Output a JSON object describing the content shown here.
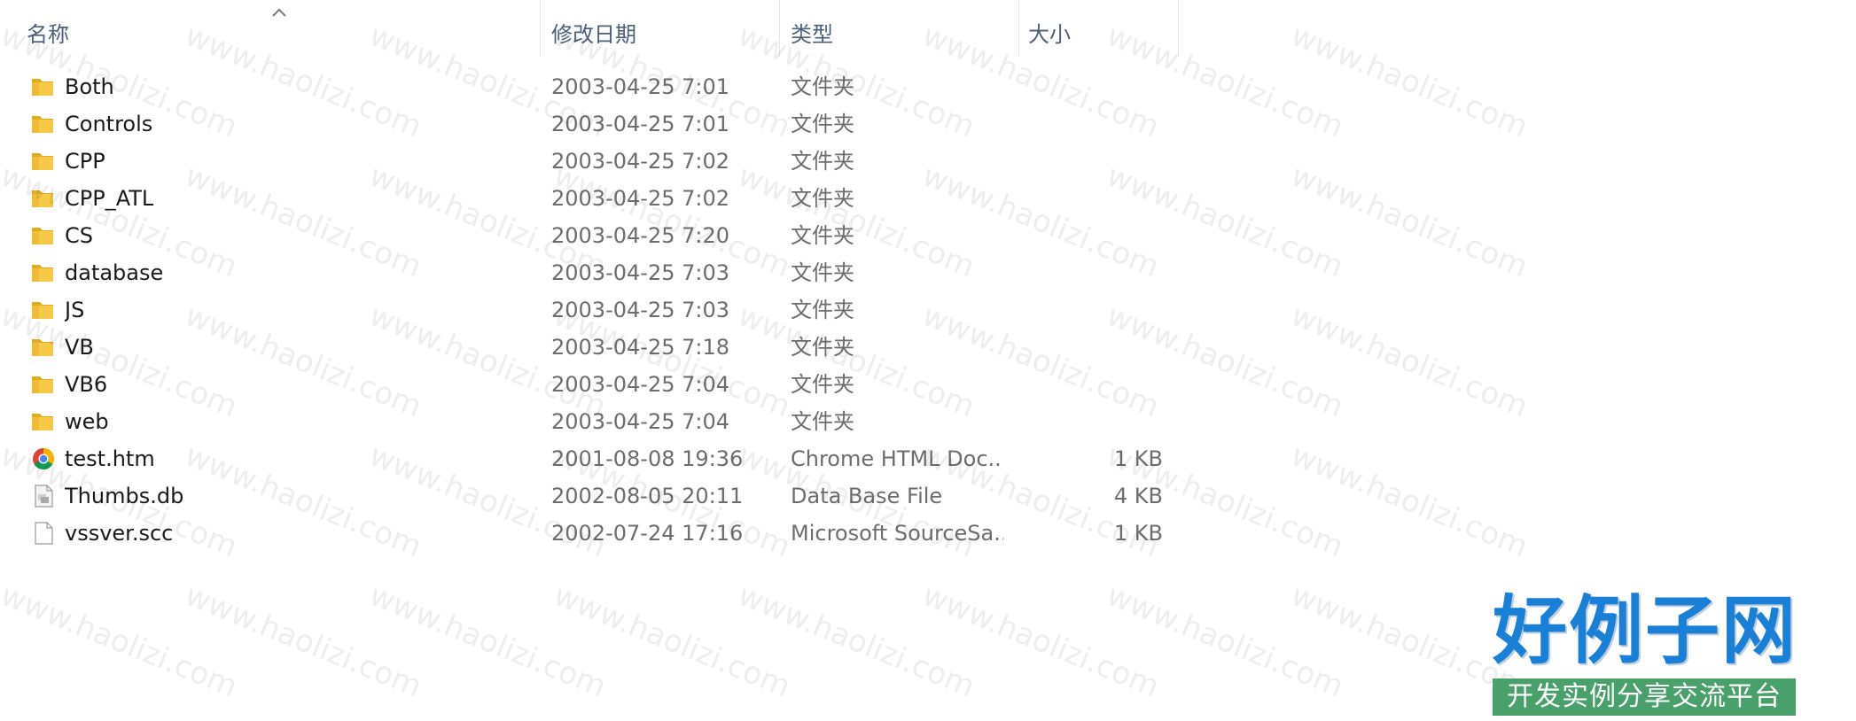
{
  "columns": {
    "name": "名称",
    "date": "修改日期",
    "type": "类型",
    "size": "大小"
  },
  "sort": {
    "column": "name",
    "direction": "ascending",
    "icon": "chevron-up-icon"
  },
  "files": [
    {
      "name": "Both",
      "date": "2003-04-25 7:01",
      "type": "文件夹",
      "size": "",
      "icon": "folder-icon"
    },
    {
      "name": "Controls",
      "date": "2003-04-25 7:01",
      "type": "文件夹",
      "size": "",
      "icon": "folder-icon"
    },
    {
      "name": "CPP",
      "date": "2003-04-25 7:02",
      "type": "文件夹",
      "size": "",
      "icon": "folder-icon"
    },
    {
      "name": "CPP_ATL",
      "date": "2003-04-25 7:02",
      "type": "文件夹",
      "size": "",
      "icon": "folder-icon"
    },
    {
      "name": "CS",
      "date": "2003-04-25 7:20",
      "type": "文件夹",
      "size": "",
      "icon": "folder-icon"
    },
    {
      "name": "database",
      "date": "2003-04-25 7:03",
      "type": "文件夹",
      "size": "",
      "icon": "folder-icon"
    },
    {
      "name": "JS",
      "date": "2003-04-25 7:03",
      "type": "文件夹",
      "size": "",
      "icon": "folder-icon"
    },
    {
      "name": "VB",
      "date": "2003-04-25 7:18",
      "type": "文件夹",
      "size": "",
      "icon": "folder-icon"
    },
    {
      "name": "VB6",
      "date": "2003-04-25 7:04",
      "type": "文件夹",
      "size": "",
      "icon": "folder-icon"
    },
    {
      "name": "web",
      "date": "2003-04-25 7:04",
      "type": "文件夹",
      "size": "",
      "icon": "folder-icon"
    },
    {
      "name": "test.htm",
      "date": "2001-08-08 19:36",
      "type": "Chrome HTML Doc...",
      "size": "1 KB",
      "icon": "chrome-icon"
    },
    {
      "name": "Thumbs.db",
      "date": "2002-08-05 20:11",
      "type": "Data Base File",
      "size": "4 KB",
      "icon": "database-file-icon"
    },
    {
      "name": "vssver.scc",
      "date": "2002-07-24 17:16",
      "type": "Microsoft SourceSa...",
      "size": "1 KB",
      "icon": "blank-file-icon"
    }
  ],
  "watermark": {
    "text": "www.haolizi.com"
  },
  "logo": {
    "title": "好例子网",
    "subtitle": "开发实例分享交流平台"
  },
  "colors": {
    "folder": "#f7c948",
    "folder_dark": "#e3ac1f",
    "header_text": "#4c607a",
    "secondary_text": "#6d6d6d",
    "logo_blue": "#1a7fd6",
    "logo_green": "#4aa06a"
  }
}
